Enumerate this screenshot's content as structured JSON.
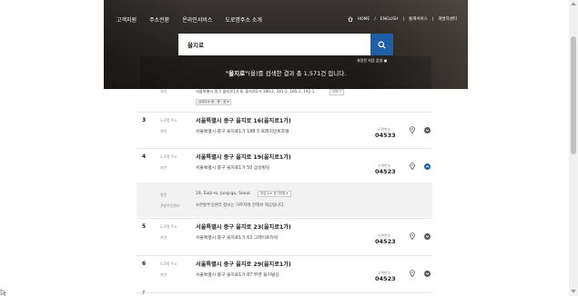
{
  "header": {
    "nav": [
      "고객지원",
      "주소전환",
      "온라인서비스",
      "도로명주소 소개"
    ],
    "util_home": "HOME",
    "util_english": "ENGLISH",
    "util_stats": "통계서비스",
    "util_dev": "개발자센터"
  },
  "search": {
    "query": "을지로",
    "detail_link": "과정된 처음 없냈",
    "result_prefix": "\"을지로\"",
    "result_suffix": "(을)를 검색한 결과 총 1,571건 입니다."
  },
  "top_item": {
    "label": "지번",
    "text": "서울특별시 중구 을지로1가 8, 을지로2가 180-2, 181-2, 185-1, 192-1",
    "more_label": "더보기",
    "tag_label": "상세주소 동 · 층 · 호 ▾"
  },
  "entries": [
    {
      "number": "3",
      "road_label": "도로명 주소",
      "road_address": "서울특별시 중구 을지로 16(을지로1가)",
      "jibun_label": "지번",
      "jibun_address": "서울특별시 중구 을지로1가 188-3 프레지던트호텔",
      "zip_label": "우편번호",
      "zip_code": "04533",
      "expanded": false
    },
    {
      "number": "4",
      "road_label": "도로명 주소",
      "road_address": "서울특별시 중구 을지로 19(을지로1가)",
      "jibun_label": "지번",
      "jibun_address": "서울특별시 중구 을지로1가 50 삼성빌딩",
      "zip_label": "우편번호",
      "zip_code": "04523",
      "expanded": true
    },
    {
      "number": "5",
      "road_label": "도로명 주소",
      "road_address": "서울특별시 중구 을지로 23(을지로1가)",
      "jibun_label": "지번",
      "jibun_address": "서울특별시 중구 을지로1가 63 그레이트타워",
      "zip_label": "우편번호",
      "zip_code": "04523",
      "expanded": false
    },
    {
      "number": "6",
      "road_label": "도로명 주소",
      "road_address": "서울특별시 중구 을지로 29(을지로1가)",
      "jibun_label": "지번",
      "jibun_address": "서울특별시 중구 을지로1가 87 부영 을지빌딩",
      "zip_label": "우편번호",
      "zip_code": "04523",
      "expanded": false
    }
  ],
  "detail": {
    "english_label": "영문",
    "english_address": "19, Eulji-ro, Jung-gu, Seoul",
    "english_select": "부분주소 표기방법 ▾",
    "office_label": "관할주민센터",
    "office_note": "※관할주민센터 정보는 거주지에 한해서 제공됩니다."
  },
  "next_number": "7",
  "colors": {
    "accent": "#1f5fa8",
    "hero_bg": "#2a2623",
    "detail_bg": "#f2f2f2"
  }
}
